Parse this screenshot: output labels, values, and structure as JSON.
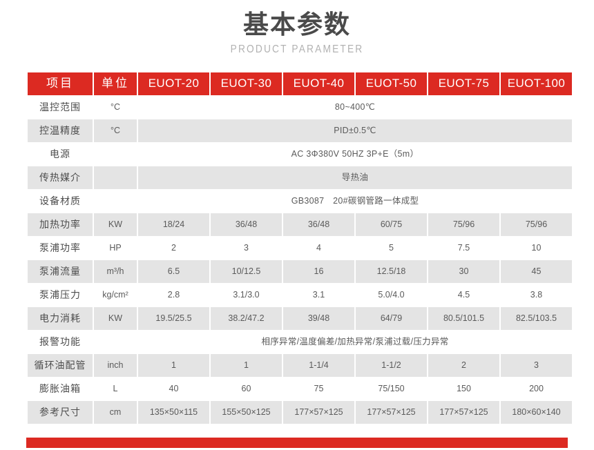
{
  "header": {
    "title": "基本参数",
    "subtitle": "PRODUCT PARAMETER"
  },
  "theme": {
    "accent_red": "#dc2a22",
    "row_shaded": "#e4e4e4",
    "row_plain": "#ffffff",
    "title_color": "#4a4a4a",
    "subtitle_color": "#b2b2b2",
    "text_color": "#555555"
  },
  "table": {
    "columns": [
      {
        "key": "item",
        "label": "项目"
      },
      {
        "key": "unit",
        "label": "单位"
      },
      {
        "key": "euot20",
        "label": "EUOT-20"
      },
      {
        "key": "euot30",
        "label": "EUOT-30"
      },
      {
        "key": "euot40",
        "label": "EUOT-40"
      },
      {
        "key": "euot50",
        "label": "EUOT-50"
      },
      {
        "key": "euot75",
        "label": "EUOT-75"
      },
      {
        "key": "euot100",
        "label": "EUOT-100"
      }
    ],
    "rows": [
      {
        "item": "温控范围",
        "unit": "°C",
        "merged": true,
        "merged_value": "80~400℃",
        "shaded": false
      },
      {
        "item": "控温精度",
        "unit": "°C",
        "merged": true,
        "merged_value": "PID±0.5℃",
        "shaded": true
      },
      {
        "item": "电源",
        "unit": "",
        "merged": true,
        "merged_value": "AC 3Φ380V 50HZ  3P+E（5m）",
        "shaded": false
      },
      {
        "item": "传热媒介",
        "unit": "",
        "merged": true,
        "merged_value": "导热油",
        "shaded": true
      },
      {
        "item": "设备材质",
        "unit": "",
        "merged": true,
        "merged_value": "GB3087　20#碳钢管路一体成型",
        "shaded": false
      },
      {
        "item": "加热功率",
        "unit": "KW",
        "merged": false,
        "values": [
          "18/24",
          "36/48",
          "36/48",
          "60/75",
          "75/96",
          "75/96"
        ],
        "shaded": true
      },
      {
        "item": "泵浦功率",
        "unit": "HP",
        "merged": false,
        "values": [
          "2",
          "3",
          "4",
          "5",
          "7.5",
          "10"
        ],
        "shaded": false
      },
      {
        "item": "泵浦流量",
        "unit": "m³/h",
        "merged": false,
        "values": [
          "6.5",
          "10/12.5",
          "16",
          "12.5/18",
          "30",
          "45"
        ],
        "shaded": true
      },
      {
        "item": "泵浦压力",
        "unit": "kg/cm²",
        "merged": false,
        "values": [
          "2.8",
          "3.1/3.0",
          "3.1",
          "5.0/4.0",
          "4.5",
          "3.8"
        ],
        "shaded": false
      },
      {
        "item": "电力消耗",
        "unit": "KW",
        "merged": false,
        "values": [
          "19.5/25.5",
          "38.2/47.2",
          "39/48",
          "64/79",
          "80.5/101.5",
          "82.5/103.5"
        ],
        "shaded": true
      },
      {
        "item": "报警功能",
        "unit": "",
        "merged": true,
        "merged_value": "相序异常/温度偏差/加热异常/泵浦过载/压力异常",
        "shaded": false
      },
      {
        "item": "循环油配管",
        "unit": "inch",
        "merged": false,
        "values": [
          "1",
          "1",
          "1-1/4",
          "1-1/2",
          "2",
          "3"
        ],
        "shaded": true
      },
      {
        "item": "膨胀油箱",
        "unit": "L",
        "merged": false,
        "values": [
          "40",
          "60",
          "75",
          "75/150",
          "150",
          "200"
        ],
        "shaded": false
      },
      {
        "item": "参考尺寸",
        "unit": "cm",
        "merged": false,
        "values": [
          "135×50×115",
          "155×50×125",
          "177×57×125",
          "177×57×125",
          "177×57×125",
          "180×60×140"
        ],
        "shaded": true
      }
    ]
  },
  "footer": {
    "bar_color": "#dc2a22"
  }
}
